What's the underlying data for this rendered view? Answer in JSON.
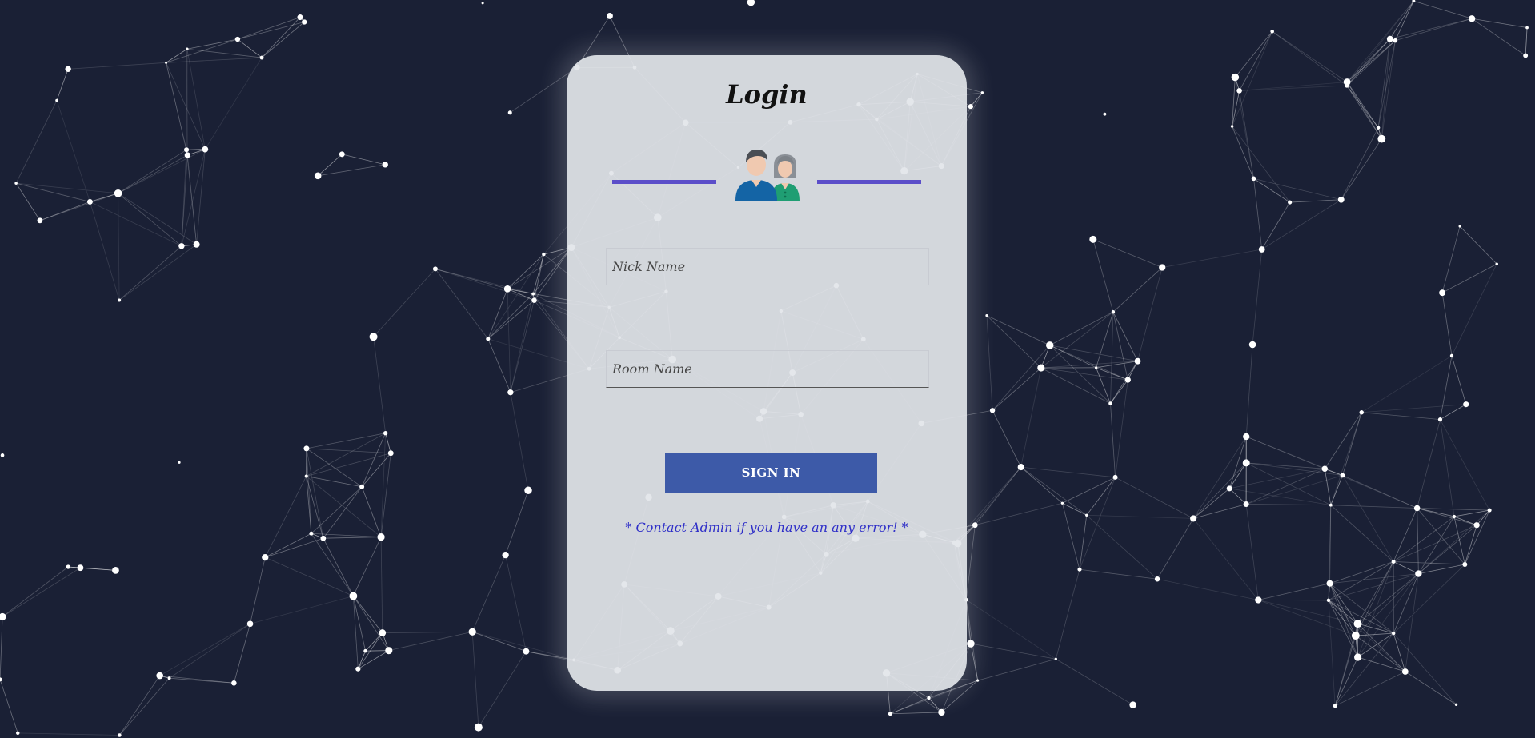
{
  "login": {
    "title": "Login",
    "nick_name": {
      "placeholder": "Nick Name",
      "value": ""
    },
    "room_name": {
      "placeholder": "Room Name",
      "value": ""
    },
    "sign_in_label": "SIGN IN",
    "contact_link": "* Contact Admin if you have an any error! *"
  },
  "colors": {
    "background": "#1a2035",
    "card": "#e2e5ea",
    "divider": "#5b4ec9",
    "button": "#3d5aa8",
    "link": "#3030c8"
  },
  "icons": {
    "avatar": "users-couple-icon"
  }
}
